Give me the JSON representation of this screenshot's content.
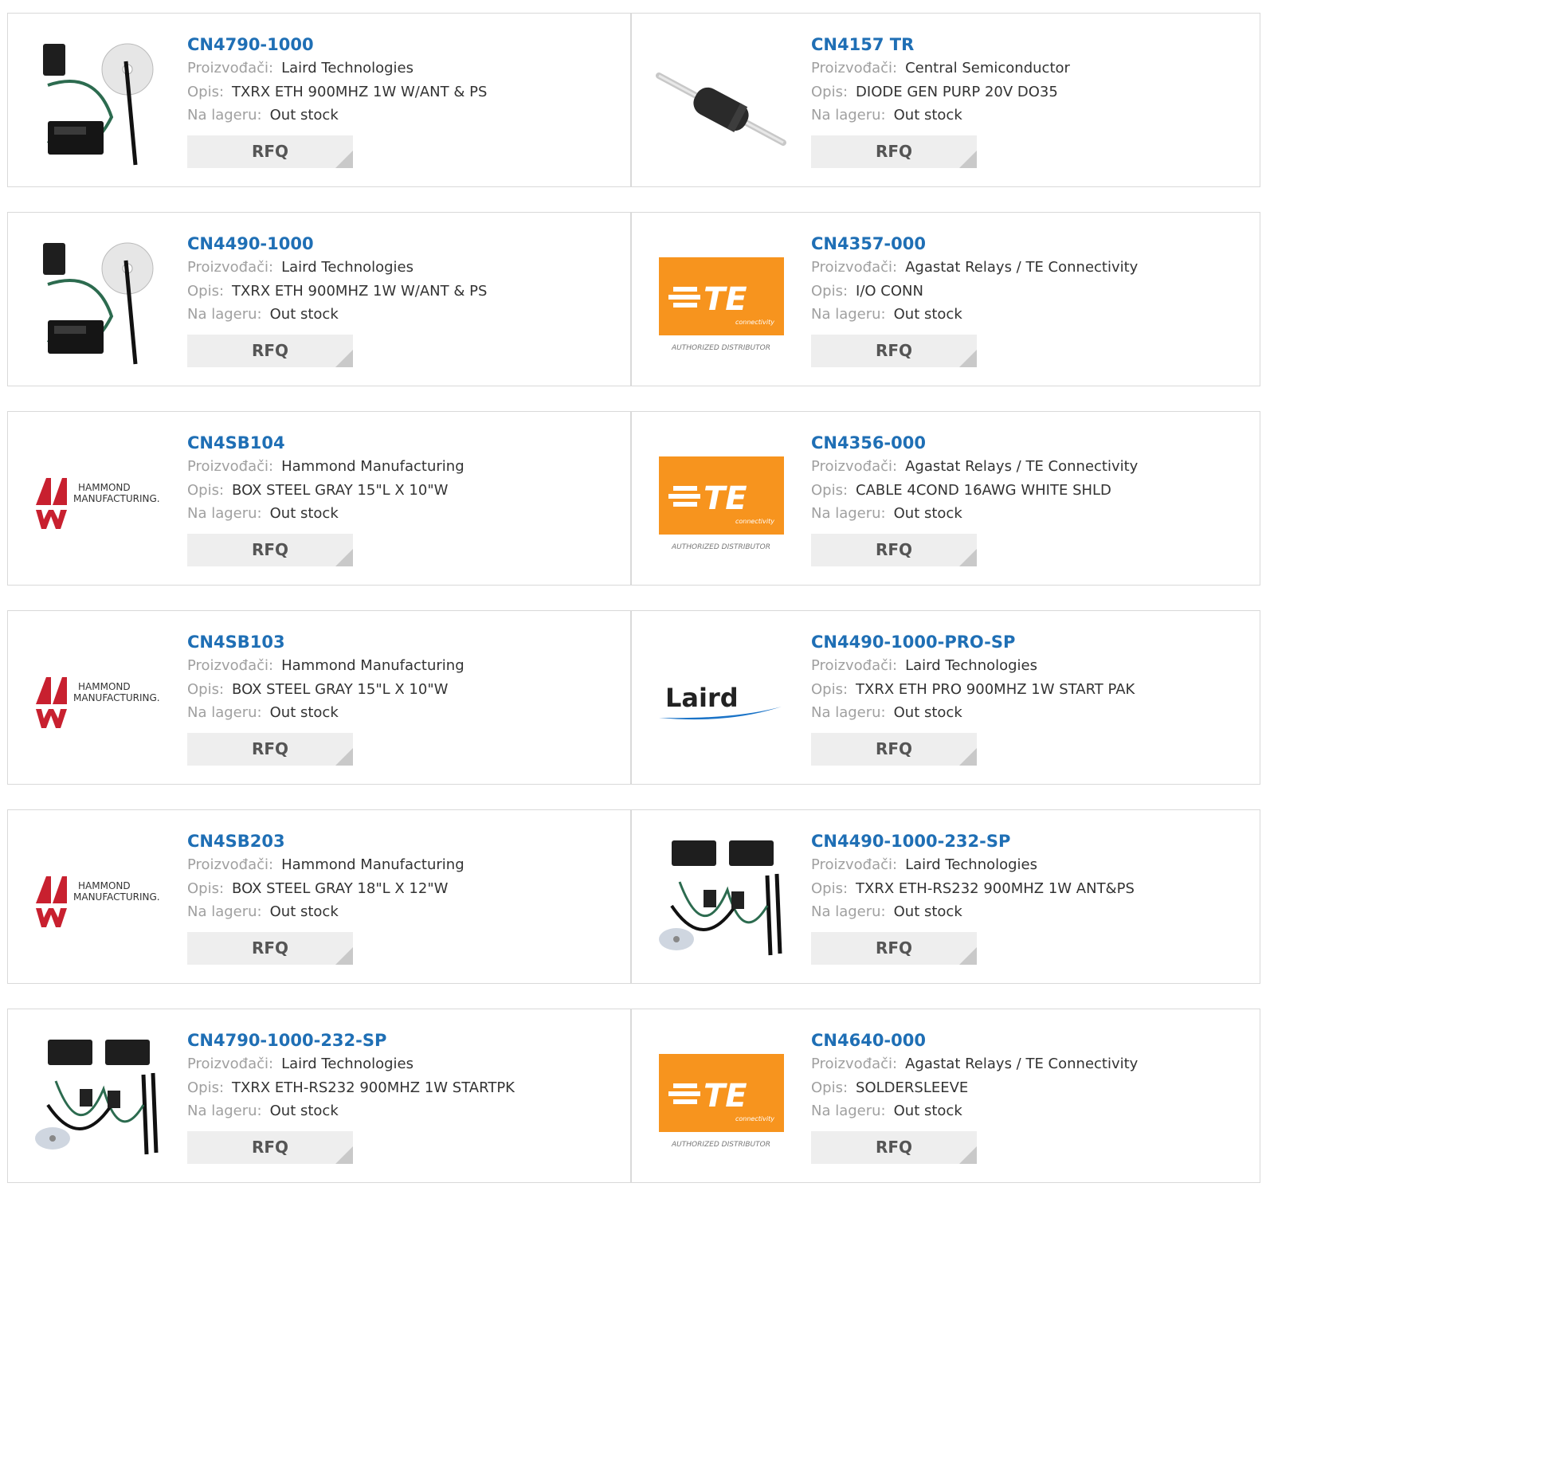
{
  "labels": {
    "manufacturer": "Proizvođači:",
    "description": "Opis:",
    "stock": "Na lageru:",
    "rfq": "RFQ"
  },
  "colors": {
    "part_link": "#1f6fb5",
    "te_orange": "#f7941e",
    "hammond_red": "#c8202f",
    "laird_blue": "#1a73c7"
  },
  "products": [
    {
      "part": "CN4790-1000",
      "manufacturer": "Laird Technologies",
      "description": "TXRX ETH 900MHZ 1W W/ANT & PS",
      "stock": "Out stock",
      "image": "kit-cd-antenna"
    },
    {
      "part": "CN4157 TR",
      "manufacturer": "Central Semiconductor",
      "description": "DIODE GEN PURP 20V DO35",
      "stock": "Out stock",
      "image": "diode"
    },
    {
      "part": "CN4490-1000",
      "manufacturer": "Laird Technologies",
      "description": "TXRX ETH 900MHZ 1W W/ANT & PS",
      "stock": "Out stock",
      "image": "kit-cd-antenna"
    },
    {
      "part": "CN4357-000",
      "manufacturer": "Agastat Relays / TE Connectivity",
      "description": "I/O CONN",
      "stock": "Out stock",
      "image": "te-logo"
    },
    {
      "part": "CN4SB104",
      "manufacturer": "Hammond Manufacturing",
      "description": "BOX STEEL GRAY 15\"L X 10\"W",
      "stock": "Out stock",
      "image": "hammond-logo"
    },
    {
      "part": "CN4356-000",
      "manufacturer": "Agastat Relays / TE Connectivity",
      "description": "CABLE 4COND 16AWG WHITE SHLD",
      "stock": "Out stock",
      "image": "te-logo"
    },
    {
      "part": "CN4SB103",
      "manufacturer": "Hammond Manufacturing",
      "description": "BOX STEEL GRAY 15\"L X 10\"W",
      "stock": "Out stock",
      "image": "hammond-logo"
    },
    {
      "part": "CN4490-1000-PRO-SP",
      "manufacturer": "Laird Technologies",
      "description": "TXRX ETH PRO 900MHZ 1W START PAK",
      "stock": "Out stock",
      "image": "laird-logo"
    },
    {
      "part": "CN4SB203",
      "manufacturer": "Hammond Manufacturing",
      "description": "BOX STEEL GRAY 18\"L X 12\"W",
      "stock": "Out stock",
      "image": "hammond-logo"
    },
    {
      "part": "CN4490-1000-232-SP",
      "manufacturer": "Laird Technologies",
      "description": "TXRX ETH-RS232 900MHZ 1W ANT&PS",
      "stock": "Out stock",
      "image": "kit-two-modules"
    },
    {
      "part": "CN4790-1000-232-SP",
      "manufacturer": "Laird Technologies",
      "description": "TXRX ETH-RS232 900MHZ 1W STARTPK",
      "stock": "Out stock",
      "image": "kit-two-modules"
    },
    {
      "part": "CN4640-000",
      "manufacturer": "Agastat Relays / TE Connectivity",
      "description": "SOLDERSLEEVE",
      "stock": "Out stock",
      "image": "te-logo"
    }
  ],
  "logo_text": {
    "te": "TE",
    "te_sub": "connectivity",
    "te_caption": "AUTHORIZED DISTRIBUTOR",
    "hammond_line1": "HAMMOND",
    "hammond_line2": "MANUFACTURING.",
    "laird": "Laird"
  }
}
